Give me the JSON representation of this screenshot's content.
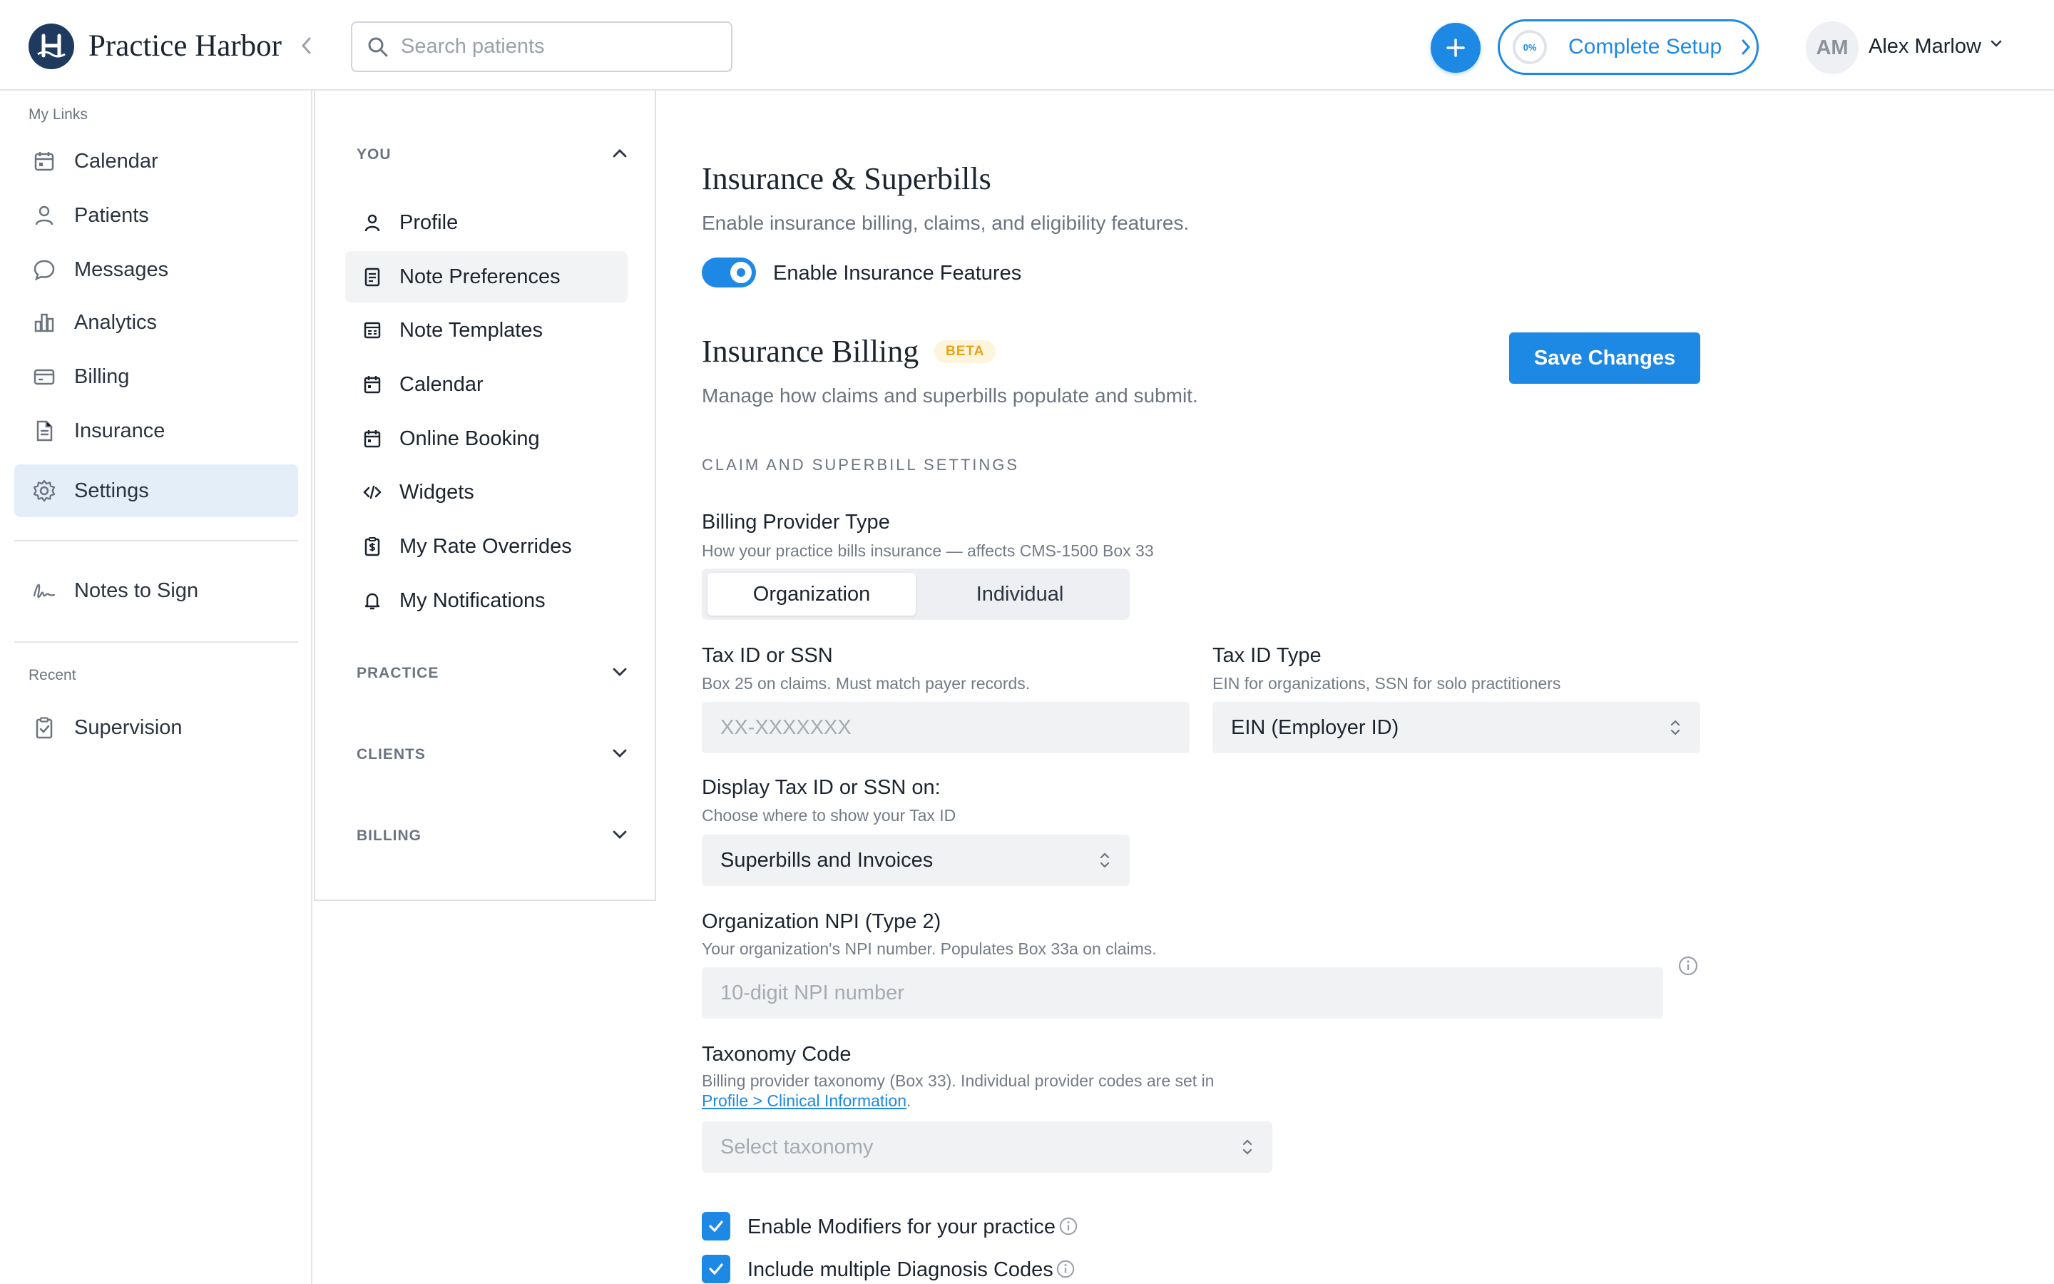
{
  "header": {
    "app_name": "Practice Harbor",
    "search_placeholder": "Search patients",
    "setup_progress": "0%",
    "setup_label": "Complete Setup",
    "user_initials": "AM",
    "user_name": "Alex Marlow"
  },
  "leftnav": {
    "my_links_title": "My Links",
    "items": [
      {
        "label": "Calendar",
        "icon": "calendar-icon"
      },
      {
        "label": "Patients",
        "icon": "user-icon"
      },
      {
        "label": "Messages",
        "icon": "chat-bubble-icon"
      },
      {
        "label": "Analytics",
        "icon": "bar-chart-icon"
      },
      {
        "label": "Billing",
        "icon": "credit-card-icon"
      },
      {
        "label": "Insurance",
        "icon": "document-icon"
      },
      {
        "label": "Settings",
        "icon": "gear-icon"
      }
    ],
    "notes_to_sign": "Notes to Sign",
    "recent_title": "Recent",
    "recent_items": [
      {
        "label": "Supervision",
        "icon": "clipboard-check-icon"
      }
    ]
  },
  "settings_menu": {
    "groups": [
      "YOU",
      "PRACTICE",
      "CLIENTS",
      "BILLING"
    ],
    "you_items": [
      {
        "label": "Profile",
        "icon": "user-icon"
      },
      {
        "label": "Note Preferences",
        "icon": "note-icon"
      },
      {
        "label": "Note Templates",
        "icon": "template-icon"
      },
      {
        "label": "Calendar",
        "icon": "calendar-icon"
      },
      {
        "label": "Online Booking",
        "icon": "calendar-check-icon"
      },
      {
        "label": "Widgets",
        "icon": "code-icon"
      },
      {
        "label": "My Rate Overrides",
        "icon": "dollar-clipboard-icon"
      },
      {
        "label": "My Notifications",
        "icon": "bell-icon"
      }
    ],
    "active_item": "Note Preferences"
  },
  "content": {
    "title": "Insurance & Superbills",
    "subtitle": "Enable insurance billing, claims, and eligibility features.",
    "toggle_label": "Enable Insurance Features",
    "toggle_on": true,
    "billing_title": "Insurance Billing",
    "beta_badge": "BETA",
    "save_label": "Save Changes",
    "billing_subtitle": "Manage how claims and superbills populate and submit.",
    "section_caps": "CLAIM AND SUPERBILL SETTINGS",
    "provider_type": {
      "label": "Billing Provider Type",
      "help": "How your practice bills insurance — affects CMS-1500 Box 33",
      "options": [
        "Organization",
        "Individual"
      ],
      "selected": "Organization"
    },
    "tax_id": {
      "label": "Tax ID or SSN",
      "help": "Box 25 on claims. Must match payer records.",
      "placeholder": "XX-XXXXXXX"
    },
    "tax_id_type": {
      "label": "Tax ID Type",
      "help": "EIN for organizations, SSN for solo practitioners",
      "value": "EIN (Employer ID)"
    },
    "display_tax": {
      "label": "Display Tax ID or SSN on:",
      "help": "Choose where to show your Tax ID",
      "value": "Superbills and Invoices"
    },
    "npi": {
      "label": "Organization NPI (Type 2)",
      "help": "Your organization's NPI number. Populates Box 33a on claims.",
      "placeholder": "10-digit NPI number"
    },
    "taxonomy": {
      "label": "Taxonomy Code",
      "help_text": "Billing provider taxonomy (Box 33). Individual provider codes are set in",
      "help_link": "Profile > Clinical Information",
      "help_end": ".",
      "placeholder": "Select taxonomy"
    },
    "checkboxes": [
      {
        "label": "Enable Modifiers for your practice",
        "checked": true
      },
      {
        "label": "Include multiple Diagnosis Codes",
        "checked": true
      }
    ]
  },
  "colors": {
    "accent": "#1e88e5",
    "active_nav": "#e4eef9",
    "brand": "#1e3a5f",
    "beta_text": "#e8a317"
  }
}
